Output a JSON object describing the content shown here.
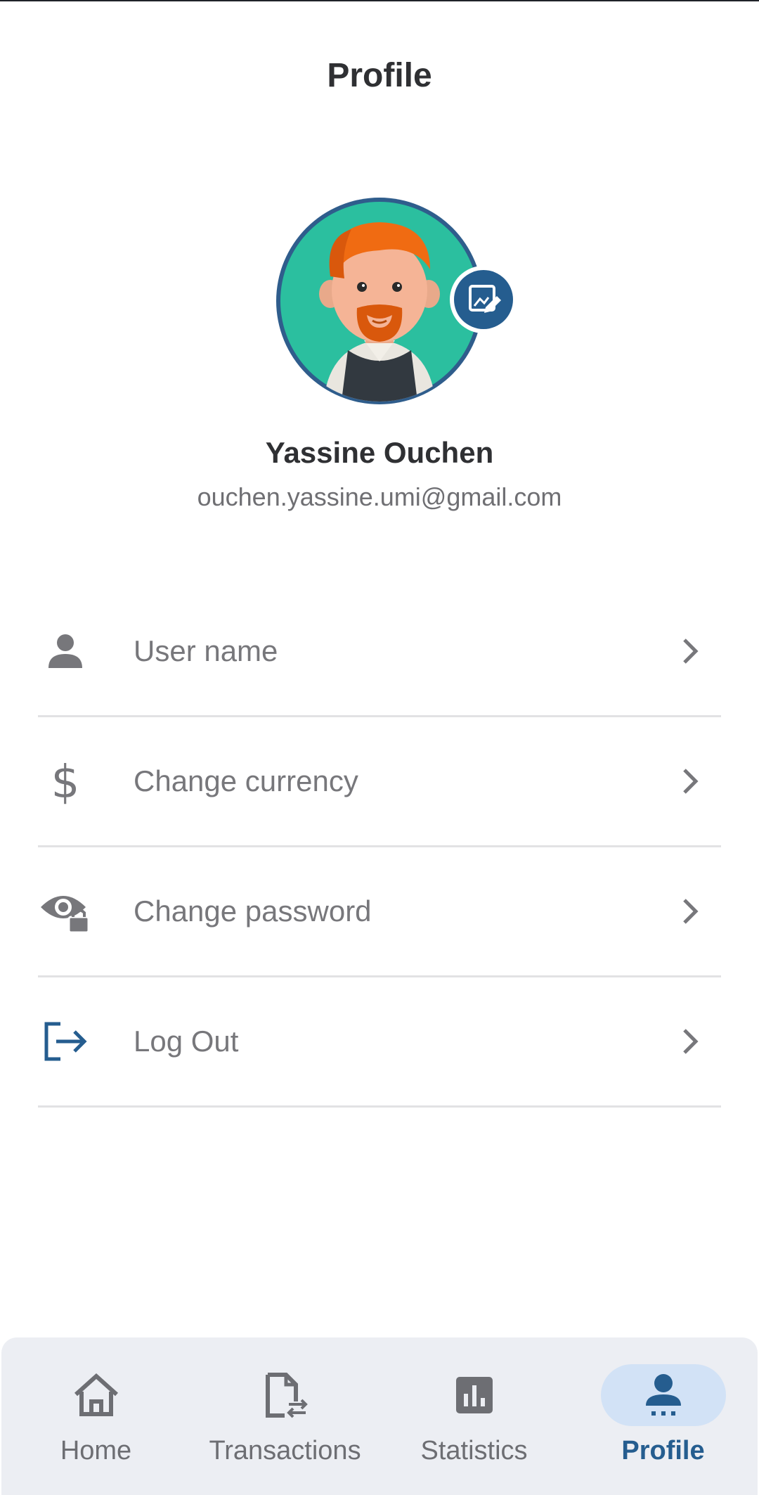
{
  "header": {
    "title": "Profile"
  },
  "profile": {
    "name": "Yassine Ouchen",
    "email": "ouchen.yassine.umi@gmail.com",
    "avatar_icon": "cartoon-man-avatar",
    "edit_icon": "edit-image-icon"
  },
  "menu": {
    "items": [
      {
        "label": "User name",
        "icon": "person-icon"
      },
      {
        "label": "Change currency",
        "icon": "dollar-icon"
      },
      {
        "label": "Change password",
        "icon": "eye-lock-icon"
      },
      {
        "label": "Log Out",
        "icon": "logout-icon"
      }
    ]
  },
  "bottom_nav": {
    "items": [
      {
        "label": "Home",
        "icon": "home-icon",
        "active": false
      },
      {
        "label": "Transactions",
        "icon": "transactions-icon",
        "active": false
      },
      {
        "label": "Statistics",
        "icon": "statistics-icon",
        "active": false
      },
      {
        "label": "Profile",
        "icon": "profile-icon",
        "active": true
      }
    ]
  },
  "colors": {
    "accent": "#255d8f",
    "active_pill": "#d2e2f6",
    "nav_background": "#eceef3",
    "avatar_background": "#2bbf9f"
  }
}
